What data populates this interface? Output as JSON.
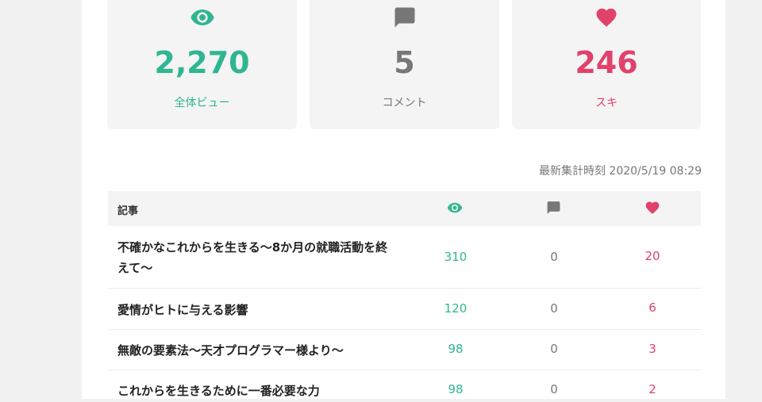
{
  "summary": {
    "views": {
      "value": "2,270",
      "label": "全体ビュー"
    },
    "comments": {
      "value": "5",
      "label": "コメント"
    },
    "likes": {
      "value": "246",
      "label": "スキ"
    }
  },
  "timestamp": "最新集計時刻 2020/5/19 08:29",
  "table": {
    "header": {
      "title": "記事"
    },
    "rows": [
      {
        "title": "不確かなこれからを生きる〜8か月の就職活動を終えて〜",
        "views": "310",
        "comments": "0",
        "likes": "20"
      },
      {
        "title": "愛情がヒトに与える影響",
        "views": "120",
        "comments": "0",
        "likes": "6"
      },
      {
        "title": "無敵の要素法〜天才プログラマー様より〜",
        "views": "98",
        "comments": "0",
        "likes": "3"
      },
      {
        "title": "これからを生きるために一番必要な力",
        "views": "98",
        "comments": "0",
        "likes": "2"
      }
    ]
  },
  "colors": {
    "green": "#2eb691",
    "gray": "#777777",
    "pink": "#e0426b"
  },
  "icons": {
    "views": "eye-icon",
    "comments": "comment-icon",
    "likes": "heart-icon"
  }
}
